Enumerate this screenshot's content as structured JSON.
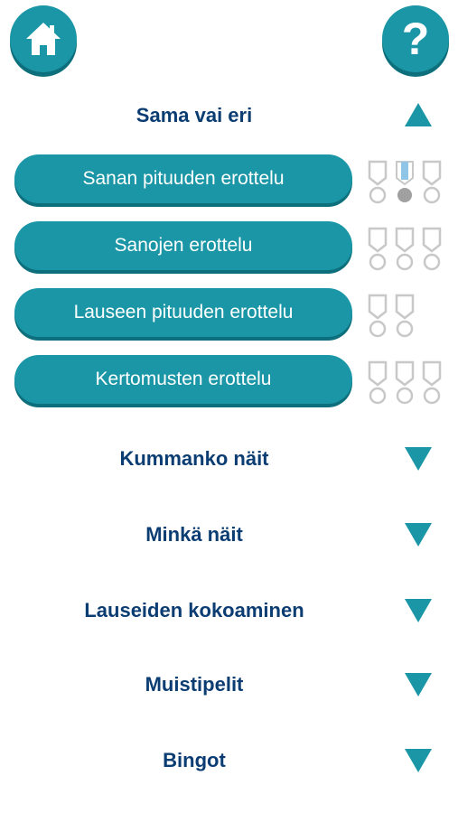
{
  "header": {
    "home_icon": "home-icon",
    "help_symbol": "?"
  },
  "colors": {
    "primary": "#1a96a6",
    "shadow": "#0d6f7b",
    "title_text": "#0b3d73",
    "medal_outline": "#c8c8c8",
    "medal_earned": "#a0a0a0",
    "ribbon_blue": "#8fc6e8"
  },
  "open_section": {
    "title": "Sama vai eri",
    "toggle_icon": "triangle-up-icon",
    "games": [
      {
        "label": "Sanan pituuden erottelu",
        "medals": [
          0,
          1,
          0
        ]
      },
      {
        "label": "Sanojen erottelu",
        "medals": [
          0,
          0,
          0
        ]
      },
      {
        "label": "Lauseen pituuden erottelu",
        "medals": [
          0,
          0
        ]
      },
      {
        "label": "Kertomusten erottelu",
        "medals": [
          0,
          0,
          0
        ]
      }
    ]
  },
  "collapsed_sections": [
    {
      "title": "Kummanko näit",
      "toggle_icon": "triangle-down-icon"
    },
    {
      "title": "Minkä näit",
      "toggle_icon": "triangle-down-icon"
    },
    {
      "title": "Lauseiden kokoaminen",
      "toggle_icon": "triangle-down-icon"
    },
    {
      "title": "Muistipelit",
      "toggle_icon": "triangle-down-icon"
    },
    {
      "title": "Bingot",
      "toggle_icon": "triangle-down-icon"
    }
  ]
}
